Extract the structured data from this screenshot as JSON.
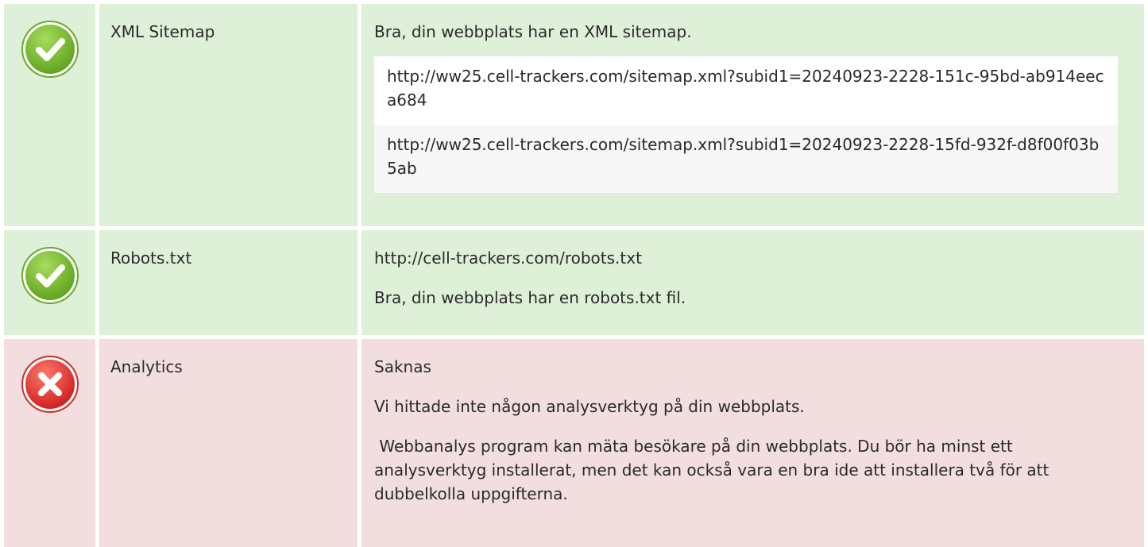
{
  "rows": [
    {
      "status": "ok",
      "icon": "check-circle-icon",
      "label": "XML Sitemap",
      "message": "Bra, din webbplats har en XML sitemap.",
      "urls": [
        "http://ww25.cell-trackers.com/sitemap.xml?subid1=20240923-2228-151c-95bd-ab914eeca684",
        "http://ww25.cell-trackers.com/sitemap.xml?subid1=20240923-2228-15fd-932f-d8f00f03b5ab"
      ]
    },
    {
      "status": "ok",
      "icon": "check-circle-icon",
      "label": "Robots.txt",
      "lines": [
        "http://cell-trackers.com/robots.txt",
        "Bra, din webbplats har en robots.txt fil."
      ]
    },
    {
      "status": "bad",
      "icon": "error-circle-icon",
      "label": "Analytics",
      "lines": [
        "Saknas",
        "Vi hittade inte någon analysverktyg på din webbplats.",
        " Webbanalys program kan mäta besökare på din webbplats. Du bör ha minst ett analysverktyg installerat, men det kan också vara en bra ide att installera två för att dubbelkolla uppgifterna."
      ]
    }
  ],
  "colors": {
    "ok_bg": "#dff0d8",
    "bad_bg": "#f2dede",
    "ok_icon": "#7cc242",
    "bad_icon": "#e0393a"
  }
}
